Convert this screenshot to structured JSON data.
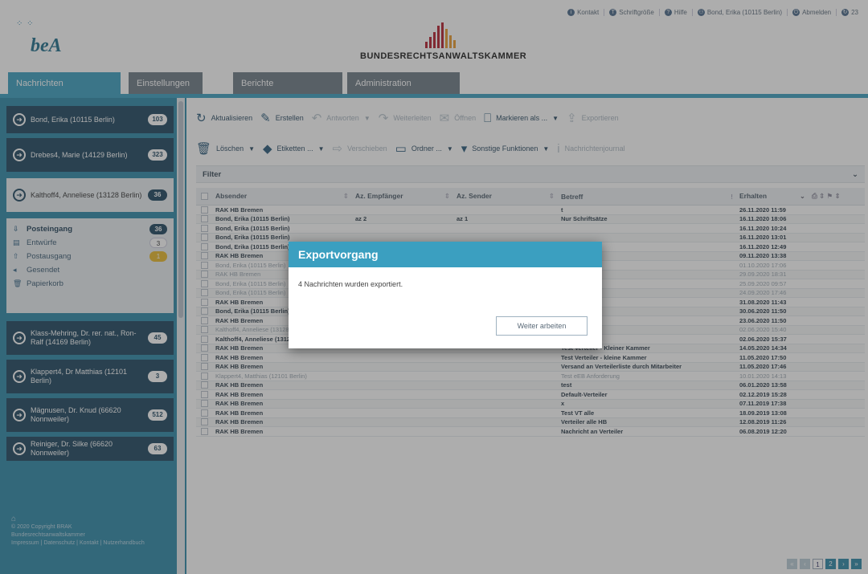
{
  "toplinks": [
    {
      "icon": "info-icon",
      "label": "Kontakt"
    },
    {
      "icon": "text-size-icon",
      "label": "Schriftgröße"
    },
    {
      "icon": "help-icon",
      "label": "Hilfe"
    },
    {
      "icon": "user-icon",
      "label": "Bond, Erika (10115 Berlin)"
    },
    {
      "icon": "logout-icon",
      "label": "Abmelden"
    },
    {
      "icon": "timer-icon",
      "label": "23"
    }
  ],
  "logo": {
    "text": "beA"
  },
  "brak": {
    "name": "BUNDESRECHTSANWALTSKAMMER"
  },
  "nav": [
    {
      "label": "Nachrichten",
      "active": true
    },
    {
      "label": "Einstellungen",
      "active": false
    },
    {
      "label": "Berichte",
      "active": false
    },
    {
      "label": "Administration",
      "active": false
    }
  ],
  "mailboxes": [
    {
      "label": "Bond, Erika (10115 Berlin)",
      "count": "103"
    },
    {
      "label": "Drebes4, Marie (14129 Berlin)",
      "count": "323"
    },
    {
      "label": "Kalthoff4, Anneliese (13128 Berlin)",
      "count": "36"
    },
    {
      "label": "Klass-Mehring, Dr. rer. nat., Ron-Ralf (14169 Berlin)",
      "count": "45"
    },
    {
      "label": "Klappert4, Dr Matthias (12101 Berlin)",
      "count": "3"
    },
    {
      "label": "Mägnusen, Dr. Knud (66620 Nonnweiler)",
      "count": "512"
    },
    {
      "label": "Reiniger, Dr. Silke (66620 Nonnweiler)",
      "count": "63"
    }
  ],
  "folders": [
    {
      "icon": "inbox-icon",
      "label": "Posteingang",
      "count": "36",
      "style": "dark",
      "bold": true
    },
    {
      "icon": "drafts-icon",
      "label": "Entwürfe",
      "count": "3",
      "style": "white",
      "bold": false
    },
    {
      "icon": "outbox-icon",
      "label": "Postausgang",
      "count": "1",
      "style": "yellow",
      "bold": false
    },
    {
      "icon": "sent-icon",
      "label": "Gesendet",
      "count": "",
      "style": "",
      "bold": false
    },
    {
      "icon": "trash-icon",
      "label": "Papierkorb",
      "count": "",
      "style": "",
      "bold": false
    }
  ],
  "footer": {
    "line1": "© 2020 Copyright BRAK",
    "line2": "Bundesrechtsanwaltskammer",
    "line3": "Impressum | Datenschutz | Kontakt | Nutzerhandbuch"
  },
  "toolbar1": [
    {
      "icon": "refresh-icon",
      "label": "Aktualisieren",
      "enabled": true,
      "dropdown": false
    },
    {
      "icon": "pencil-icon",
      "label": "Erstellen",
      "enabled": true,
      "dropdown": false
    },
    {
      "icon": "reply-icon",
      "label": "Antworten",
      "enabled": false,
      "dropdown": true
    },
    {
      "icon": "forward-icon",
      "label": "Weiterleiten",
      "enabled": false,
      "dropdown": false
    },
    {
      "icon": "envelope-icon",
      "label": "Öffnen",
      "enabled": false,
      "dropdown": false
    },
    {
      "icon": "bookmark-icon",
      "label": "Markieren als ...",
      "enabled": true,
      "dropdown": true
    },
    {
      "icon": "export-icon",
      "label": "Exportieren",
      "enabled": false,
      "dropdown": false
    }
  ],
  "toolbar2": [
    {
      "icon": "trash-icon",
      "label": "Löschen",
      "enabled": true,
      "dropdown": true
    },
    {
      "icon": "tag-icon",
      "label": "Etiketten ...",
      "enabled": true,
      "dropdown": true
    },
    {
      "icon": "move-folder-icon",
      "label": "Verschieben",
      "enabled": false,
      "dropdown": false
    },
    {
      "icon": "folder-icon",
      "label": "Ordner ...",
      "enabled": true,
      "dropdown": true
    },
    {
      "icon": "more-functions-icon",
      "label": "Sonstige Funktionen",
      "enabled": true,
      "dropdown": true
    },
    {
      "icon": "info-icon",
      "label": "Nachrichtenjournal",
      "enabled": false,
      "dropdown": false
    }
  ],
  "filter": {
    "label": "Filter"
  },
  "columns": {
    "sender": "Absender",
    "recipient_ref": "Az. Empfänger",
    "sender_ref": "Az. Sender",
    "subject": "Betreff",
    "received": "Erhalten"
  },
  "rows": [
    {
      "sender": "RAK HB Bremen",
      "az_emp": "",
      "az_sen": "",
      "subject": "t",
      "received": "26.11.2020 11:59",
      "read": false
    },
    {
      "sender": "Bond, Erika (10115 Berlin)",
      "az_emp": "az 2",
      "az_sen": "az 1",
      "subject": "Nur Schriftsätze",
      "received": "16.11.2020 18:06",
      "read": false
    },
    {
      "sender": "Bond, Erika (10115 Berlin)",
      "az_emp": "",
      "az_sen": "",
      "subject": "",
      "received": "16.11.2020 10:24",
      "read": false
    },
    {
      "sender": "Bond, Erika (10115 Berlin)",
      "az_emp": "",
      "az_sen": "",
      "subject": "",
      "received": "16.11.2020 13:01",
      "read": false
    },
    {
      "sender": "Bond, Erika (10115 Berlin)",
      "az_emp": "",
      "az_sen": "",
      "subject": "",
      "received": "16.11.2020 12:49",
      "read": false
    },
    {
      "sender": "RAK HB Bremen",
      "az_emp": "",
      "az_sen": "",
      "subject": "",
      "received": "09.11.2020 13:38",
      "read": false
    },
    {
      "sender": "Bond, Erika (10115 Berlin)",
      "az_emp": "",
      "az_sen": "",
      "subject": "",
      "received": "01.10.2020 17:06",
      "read": true
    },
    {
      "sender": "RAK HB Bremen",
      "az_emp": "",
      "az_sen": "",
      "subject": "",
      "received": "29.09.2020 18:31",
      "read": true
    },
    {
      "sender": "Bond, Erika (10115 Berlin)",
      "az_emp": "",
      "az_sen": "",
      "subject": "",
      "received": "25.09.2020 09:57",
      "read": true
    },
    {
      "sender": "Bond, Erika (10115 Berlin)",
      "az_emp": "",
      "az_sen": "",
      "subject": "",
      "received": "24.09.2020 17:46",
      "read": true
    },
    {
      "sender": "RAK HB Bremen",
      "az_emp": "",
      "az_sen": "",
      "subject": "t",
      "received": "31.08.2020 11:43",
      "read": false
    },
    {
      "sender": "Bond, Erika (10115 Berlin)",
      "az_emp": "",
      "az_sen": "",
      "subject": "aaa",
      "received": "30.06.2020 11:50",
      "read": false
    },
    {
      "sender": "RAK HB Bremen",
      "az_emp": "",
      "az_sen": "",
      "subject": "t",
      "received": "23.06.2020 11:50",
      "read": false
    },
    {
      "sender": "Kalthoff4, Anneliese (13128 Berlin)",
      "az_emp": "",
      "az_sen": "",
      "subject": "test",
      "received": "02.06.2020 15:40",
      "read": true
    },
    {
      "sender": "Kalthoff4, Anneliese (13128 Berlin)",
      "az_emp": "",
      "az_sen": "",
      "subject": "etet",
      "received": "02.06.2020 15:37",
      "read": false
    },
    {
      "sender": "RAK HB Bremen",
      "az_emp": "",
      "az_sen": "",
      "subject": "Test Verteiler - Kleiner Kammer",
      "received": "14.05.2020 14:34",
      "read": false
    },
    {
      "sender": "RAK HB Bremen",
      "az_emp": "",
      "az_sen": "",
      "subject": "Test Verteiler - kleine Kammer",
      "received": "11.05.2020 17:50",
      "read": false
    },
    {
      "sender": "RAK HB Bremen",
      "az_emp": "",
      "az_sen": "",
      "subject": "Versand an Verteilerliste durch Mitarbeiter",
      "received": "11.05.2020 17:46",
      "read": false
    },
    {
      "sender": "Klappert4, Matthias (12101 Berlin)",
      "az_emp": "",
      "az_sen": "",
      "subject": "Test eEB Anforderung",
      "received": "10.01.2020 14:13",
      "read": true
    },
    {
      "sender": "RAK HB Bremen",
      "az_emp": "",
      "az_sen": "",
      "subject": "test",
      "received": "06.01.2020 13:58",
      "read": false
    },
    {
      "sender": "RAK HB Bremen",
      "az_emp": "",
      "az_sen": "",
      "subject": "Default-Verteiler",
      "received": "02.12.2019 15:28",
      "read": false
    },
    {
      "sender": "RAK HB Bremen",
      "az_emp": "",
      "az_sen": "",
      "subject": "x",
      "received": "07.11.2019 17:38",
      "read": false
    },
    {
      "sender": "RAK HB Bremen",
      "az_emp": "",
      "az_sen": "",
      "subject": "Test VT alle",
      "received": "18.09.2019 13:08",
      "read": false
    },
    {
      "sender": "RAK HB Bremen",
      "az_emp": "",
      "az_sen": "",
      "subject": "Verteiler alle HB",
      "received": "12.08.2019 11:26",
      "read": false
    },
    {
      "sender": "RAK HB Bremen",
      "az_emp": "",
      "az_sen": "",
      "subject": "Nachricht an Verteiler",
      "received": "06.08.2019 12:20",
      "read": false
    }
  ],
  "pager": {
    "current": "1"
  },
  "modal": {
    "title": "Exportvorgang",
    "message": "4 Nachrichten wurden exportiert.",
    "button": "Weiter arbeiten"
  }
}
